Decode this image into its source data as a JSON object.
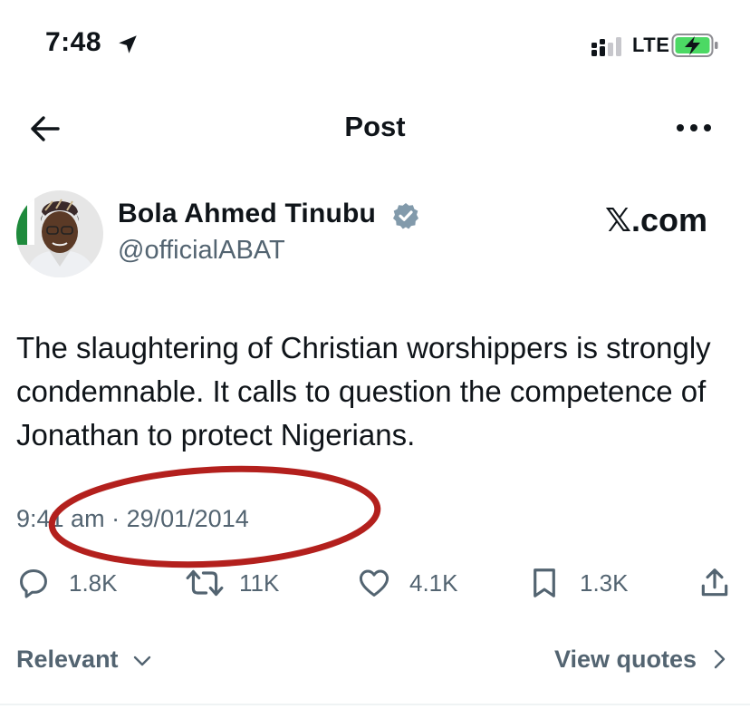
{
  "status_bar": {
    "time": "7:48",
    "network": "LTE"
  },
  "header": {
    "title": "Post"
  },
  "author": {
    "name": "Bola Ahmed Tinubu",
    "handle": "@officialABAT"
  },
  "watermark": "𝕏.com",
  "tweet": {
    "text": "The slaughtering of Christian worshippers  is strongly condemnable. It calls to question the competence of Jonathan to protect Nigerians.",
    "time": "9:41 am",
    "separator": "·",
    "date": "29/01/2014"
  },
  "actions": {
    "replies": "1.8K",
    "reposts": "11K",
    "likes": "4.1K",
    "bookmarks": "1.3K"
  },
  "footer": {
    "sort_label": "Relevant",
    "view_quotes": "View quotes"
  },
  "colors": {
    "text": "#0f1419",
    "secondary": "#536471",
    "verified": "#829aab",
    "annotation_ellipse": "#b3201d",
    "battery": "#4cd964"
  }
}
